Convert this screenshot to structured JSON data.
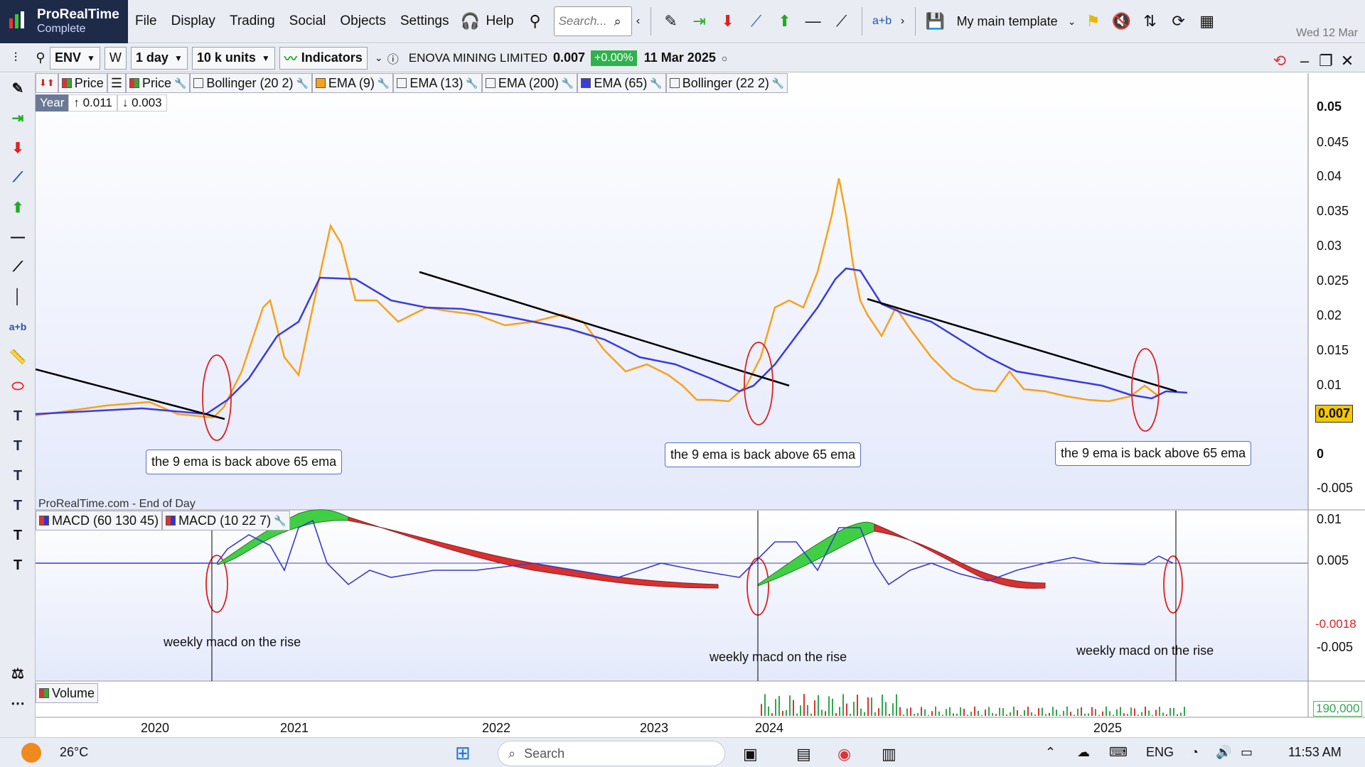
{
  "app": {
    "brand": "ProRealTime",
    "edition": "Complete",
    "menu": [
      "File",
      "Display",
      "Trading",
      "Social",
      "Objects",
      "Settings"
    ],
    "help_label": "Help",
    "search_placeholder": "Search...",
    "template_label": "My main template",
    "date_top": "Wed 12 Mar"
  },
  "toolbar2": {
    "symbol": "ENV",
    "w_label": "W",
    "period": "1 day",
    "units": "10 k units",
    "indicators_label": "Indicators",
    "instrument_name": "ENOVA MINING LIMITED",
    "price": "0.007",
    "change": "+0.00%",
    "date": "11 Mar 2025"
  },
  "legend": {
    "items": [
      {
        "label": "Price",
        "color": "#3aa040"
      },
      {
        "label": "Price",
        "color": "#3aa040"
      },
      {
        "label": "Bollinger (20 2)",
        "color": "#ffffff"
      },
      {
        "label": "EMA (9)",
        "color": "#f7a21b"
      },
      {
        "label": "EMA (13)",
        "color": "#ffffff"
      },
      {
        "label": "EMA (200)",
        "color": "#ffffff"
      },
      {
        "label": "EMA (65)",
        "color": "#3b3bdc"
      },
      {
        "label": "Bollinger (22 2)",
        "color": "#ffffff"
      }
    ],
    "period_tag": "Year",
    "high": "↑ 0.011",
    "low": "↓ 0.003"
  },
  "annotations": {
    "ema_cross": "the 9 ema is back above 65 ema",
    "macd_rise": "weekly macd on the rise",
    "source": "ProRealTime.com - End of Day"
  },
  "price_axis": {
    "ticks": [
      "0.05",
      "0.045",
      "0.04",
      "0.035",
      "0.03",
      "0.025",
      "0.02",
      "0.015",
      "0.01",
      "0",
      "-0.005"
    ],
    "current": "0.007"
  },
  "macd": {
    "legend": [
      "MACD (60 130 45)",
      "MACD (10 22 7)"
    ],
    "ticks": [
      "0.01",
      "0.005",
      "-0.005"
    ],
    "tag1": "-0.0018"
  },
  "volume": {
    "legend": "Volume",
    "tag": "190,000"
  },
  "time_axis": [
    "2020",
    "2021",
    "2022",
    "2023",
    "2024",
    "2025"
  ],
  "taskbar": {
    "temp": "26°C",
    "search": "Search",
    "lang": "ENG",
    "time": "11:53 AM"
  },
  "colors": {
    "ema9": "#f7a21b",
    "ema65": "#3b3bdc",
    "macd_up": "#3fcf45",
    "macd_down": "#d93030",
    "ellipse": "#e02020"
  }
}
